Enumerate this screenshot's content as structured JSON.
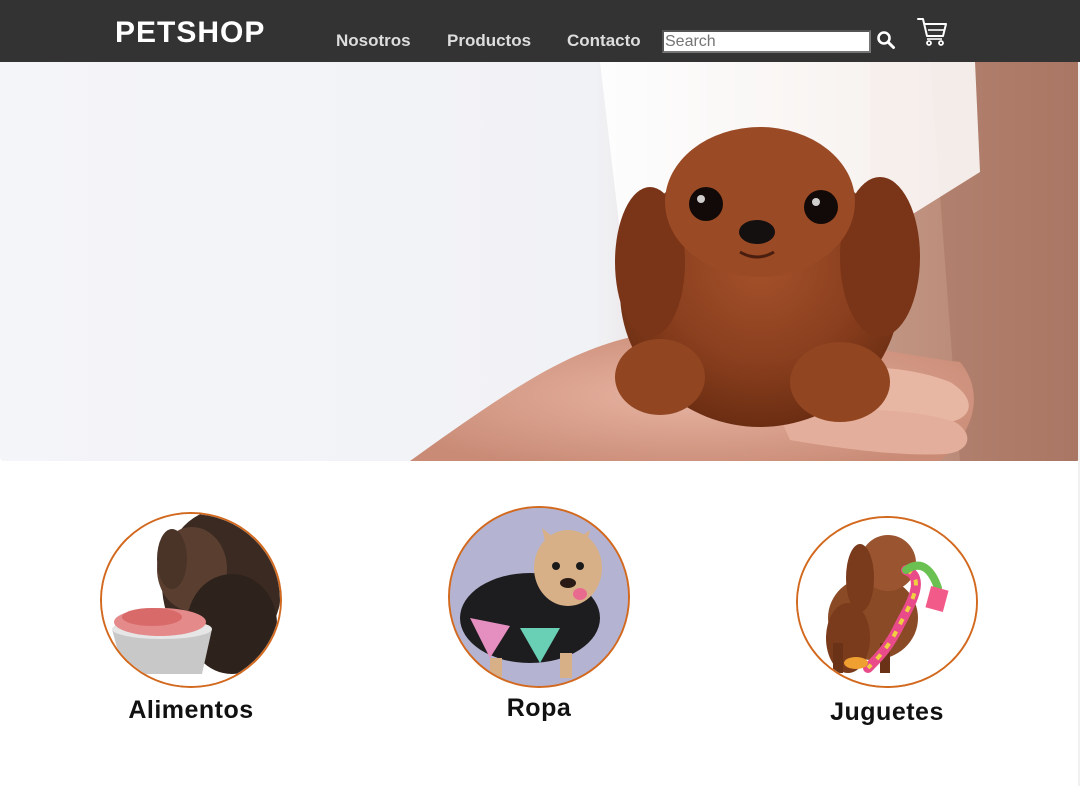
{
  "brand": "PETSHOP",
  "nav": {
    "links": [
      "Nosotros",
      "Productos",
      "Contacto"
    ]
  },
  "search": {
    "placeholder": "Search",
    "value": ""
  },
  "icons": {
    "search": "search-icon",
    "cart": "cart-icon"
  },
  "hero": {
    "image": "brown-puppy-in-hands"
  },
  "categories": [
    {
      "label": "Alimentos",
      "image": "dachshund-eating-food"
    },
    {
      "label": "Ropa",
      "image": "french-bulldog-in-hoodie"
    },
    {
      "label": "Juguetes",
      "image": "spaniel-with-rope-toy"
    }
  ],
  "colors": {
    "navbar": "#333333",
    "category_border": "#d2691e"
  }
}
